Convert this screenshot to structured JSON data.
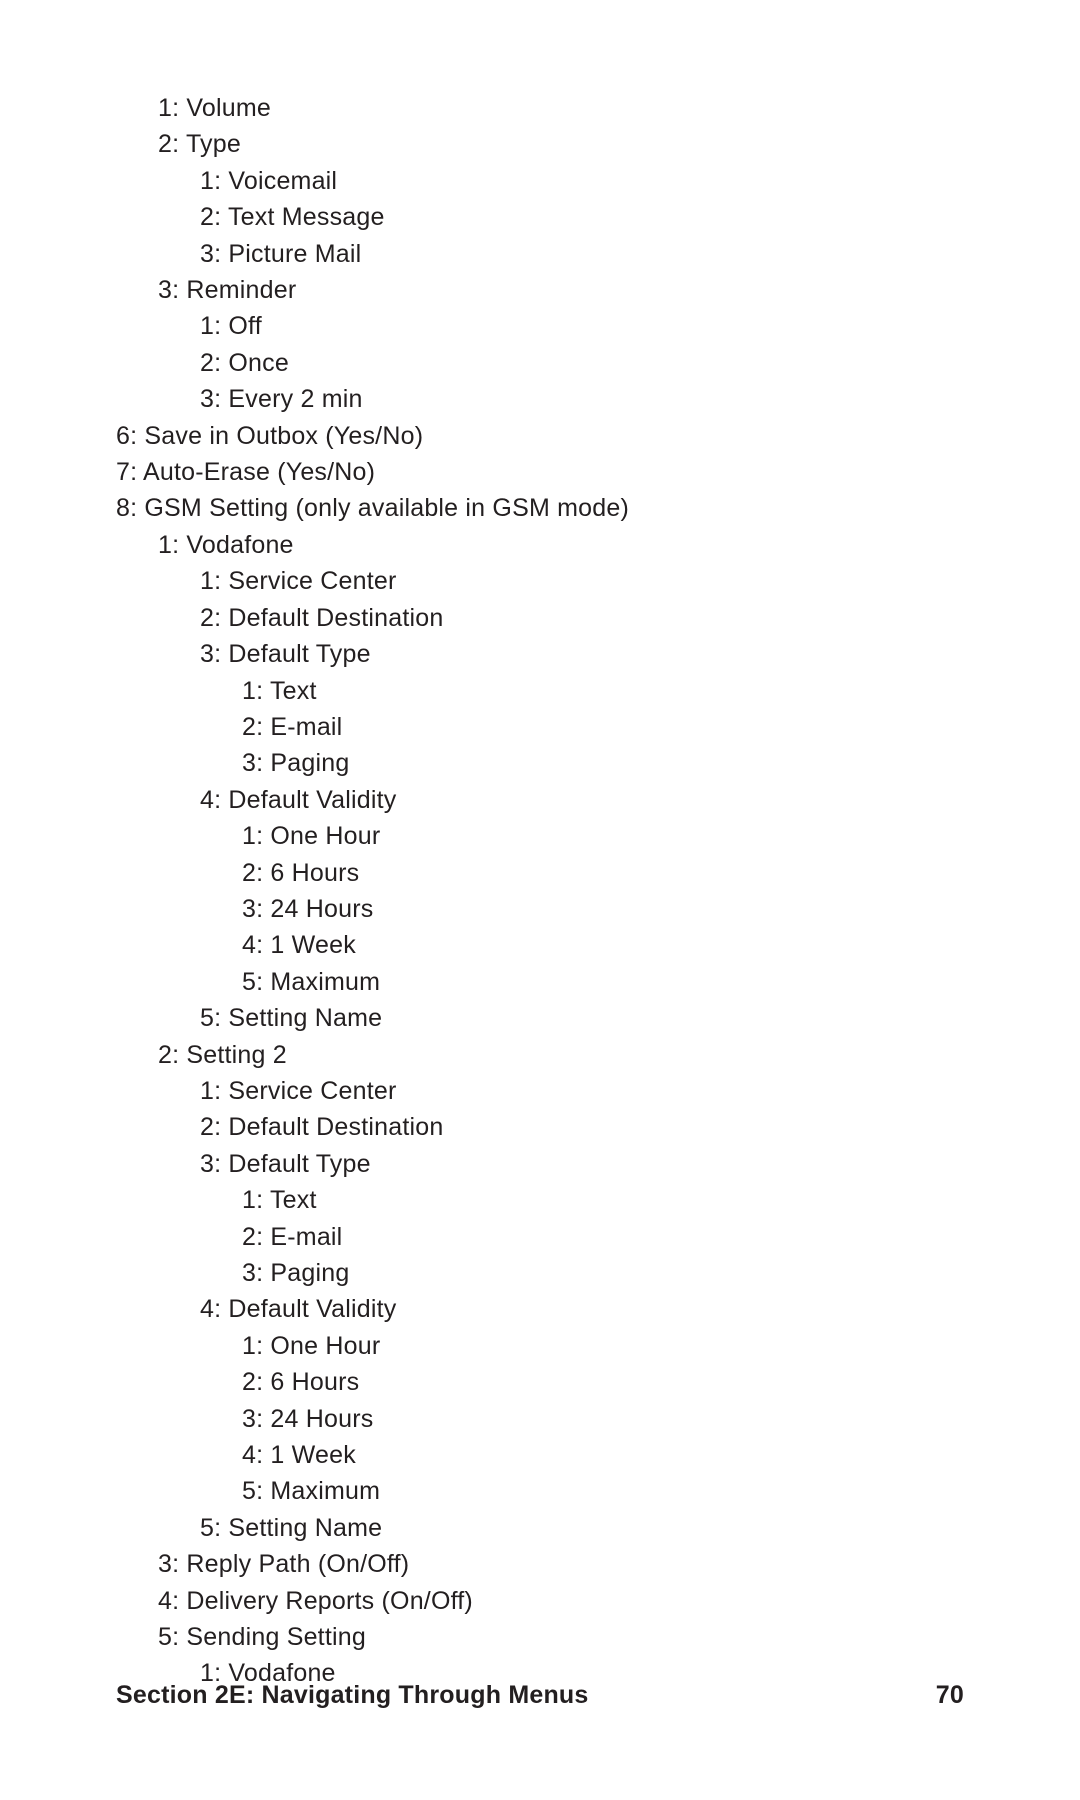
{
  "lines": [
    {
      "depth": 1,
      "text": "1: Volume"
    },
    {
      "depth": 1,
      "text": "2: Type"
    },
    {
      "depth": 2,
      "text": "1: Voicemail"
    },
    {
      "depth": 2,
      "text": "2: Text Message"
    },
    {
      "depth": 2,
      "text": "3: Picture Mail"
    },
    {
      "depth": 1,
      "text": "3: Reminder"
    },
    {
      "depth": 2,
      "text": "1: Off"
    },
    {
      "depth": 2,
      "text": "2: Once"
    },
    {
      "depth": 2,
      "text": "3: Every 2 min"
    },
    {
      "depth": 0,
      "text": "6: Save in Outbox (Yes/No)"
    },
    {
      "depth": 0,
      "text": "7: Auto-Erase (Yes/No)"
    },
    {
      "depth": 0,
      "text": "8: GSM Setting (only available in GSM mode)"
    },
    {
      "depth": 1,
      "text": "1: Vodafone"
    },
    {
      "depth": 2,
      "text": "1: Service Center"
    },
    {
      "depth": 2,
      "text": "2: Default Destination"
    },
    {
      "depth": 2,
      "text": "3: Default Type"
    },
    {
      "depth": 3,
      "text": "1: Text"
    },
    {
      "depth": 3,
      "text": "2: E-mail"
    },
    {
      "depth": 3,
      "text": "3: Paging"
    },
    {
      "depth": 2,
      "text": "4: Default Validity"
    },
    {
      "depth": 3,
      "text": "1: One Hour"
    },
    {
      "depth": 3,
      "text": "2: 6 Hours"
    },
    {
      "depth": 3,
      "text": "3: 24 Hours"
    },
    {
      "depth": 3,
      "text": "4: 1 Week"
    },
    {
      "depth": 3,
      "text": "5: Maximum"
    },
    {
      "depth": 2,
      "text": "5: Setting Name"
    },
    {
      "depth": 1,
      "text": "2: Setting 2"
    },
    {
      "depth": 2,
      "text": "1: Service Center"
    },
    {
      "depth": 2,
      "text": "2: Default Destination"
    },
    {
      "depth": 2,
      "text": "3: Default Type"
    },
    {
      "depth": 3,
      "text": "1: Text"
    },
    {
      "depth": 3,
      "text": "2: E-mail"
    },
    {
      "depth": 3,
      "text": "3: Paging"
    },
    {
      "depth": 2,
      "text": "4: Default Validity"
    },
    {
      "depth": 3,
      "text": "1: One Hour"
    },
    {
      "depth": 3,
      "text": "2: 6 Hours"
    },
    {
      "depth": 3,
      "text": "3: 24 Hours"
    },
    {
      "depth": 3,
      "text": "4: 1 Week"
    },
    {
      "depth": 3,
      "text": "5: Maximum"
    },
    {
      "depth": 2,
      "text": "5: Setting Name"
    },
    {
      "depth": 1,
      "text": "3: Reply Path (On/Off)"
    },
    {
      "depth": 1,
      "text": "4: Delivery Reports (On/Off)"
    },
    {
      "depth": 1,
      "text": "5: Sending Setting"
    },
    {
      "depth": 2,
      "text": "1: Vodafone"
    }
  ],
  "footer": {
    "section": "Section 2E: Navigating Through Menus",
    "page": "70"
  }
}
